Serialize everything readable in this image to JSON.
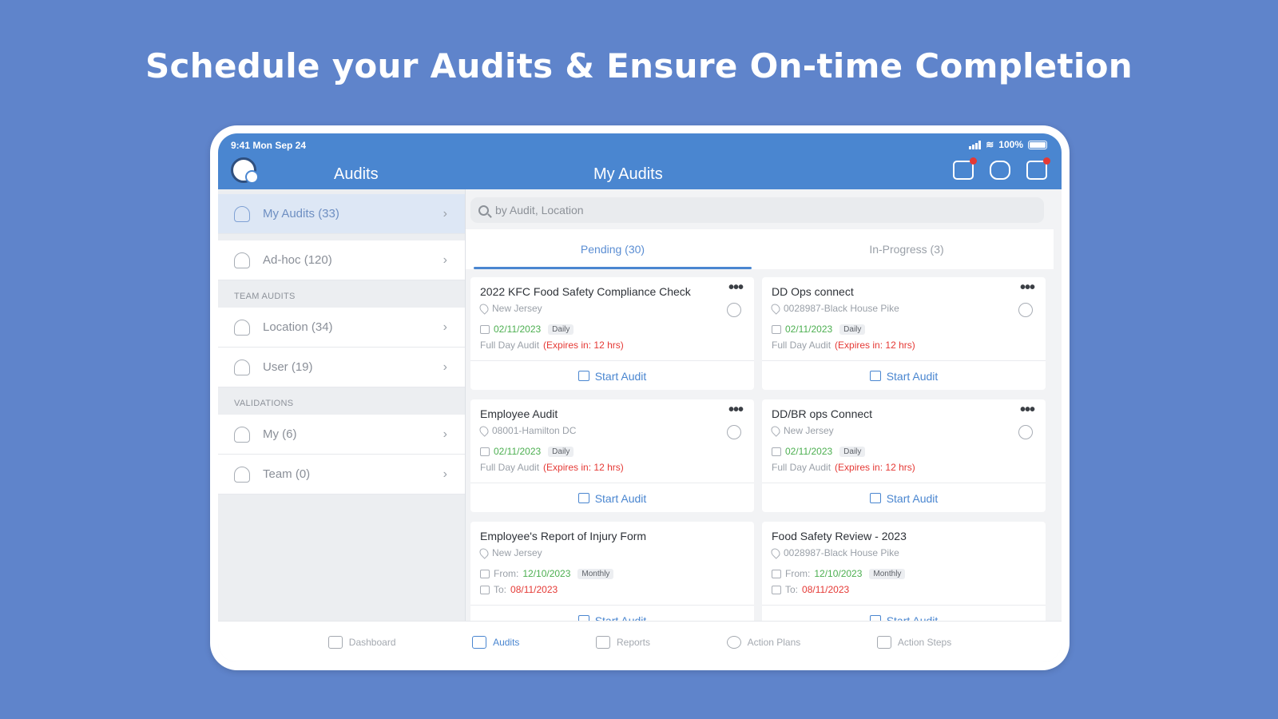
{
  "headline": "Schedule your Audits & Ensure On-time Completion",
  "status_bar": {
    "time": "9:41 Mon Sep 24",
    "battery": "100%"
  },
  "header": {
    "sidebar_title": "Audits",
    "main_title": "My Audits",
    "icons": [
      "audit-notification-icon",
      "chat-icon",
      "calendar-notification-icon"
    ]
  },
  "sidebar": {
    "items_top": [
      {
        "label": "My Audits (33)",
        "icon": "user-icon",
        "active": true
      },
      {
        "label": "Ad-hoc (120)",
        "icon": "user-icon"
      }
    ],
    "team_section": "TEAM AUDITS",
    "team_items": [
      {
        "label": "Location (34)",
        "icon": "location-icon"
      },
      {
        "label": "User (19)",
        "icon": "users-icon"
      }
    ],
    "validations_section": "VALIDATIONS",
    "validation_items": [
      {
        "label": "My (6)",
        "icon": "user-icon"
      },
      {
        "label": "Team (0)",
        "icon": "users-icon"
      }
    ]
  },
  "search": {
    "placeholder": "by Audit, Location"
  },
  "tabs": [
    {
      "label": "Pending (30)",
      "active": true
    },
    {
      "label": "In-Progress (3)"
    }
  ],
  "cards": [
    {
      "title": "2022 KFC Food Safety Compliance Check",
      "location": "New Jersey",
      "date": "02/11/2023",
      "freq": "Daily",
      "type": "Full Day Audit",
      "expires": "(Expires in: 12 hrs)",
      "action": "Start Audit"
    },
    {
      "title": "DD Ops connect",
      "location": "0028987-Black House Pike",
      "date": "02/11/2023",
      "freq": "Daily",
      "type": "Full Day Audit",
      "expires": "(Expires in: 12 hrs)",
      "action": "Start Audit"
    },
    {
      "title": "Employee Audit",
      "location": "08001-Hamilton DC",
      "date": "02/11/2023",
      "freq": "Daily",
      "type": "Full Day Audit",
      "expires": "(Expires in: 12 hrs)",
      "action": "Start Audit"
    },
    {
      "title": "DD/BR ops Connect",
      "location": "New Jersey",
      "date": "02/11/2023",
      "freq": "Daily",
      "type": "Full Day Audit",
      "expires": "(Expires in: 12 hrs)",
      "action": "Start Audit"
    },
    {
      "title": "Employee's Report of Injury Form",
      "location": "New Jersey",
      "from_label": "From:",
      "from": "12/10/2023",
      "freq": "Monthly",
      "to_label": "To:",
      "to": "08/11/2023",
      "action": "Start Audit"
    },
    {
      "title": "Food Safety Review - 2023",
      "location": "0028987-Black House Pike",
      "from_label": "From:",
      "from": "12/10/2023",
      "freq": "Monthly",
      "to_label": "To:",
      "to": "08/11/2023",
      "action": "Start Audit"
    }
  ],
  "bottom_nav": [
    {
      "label": "Dashboard",
      "icon": "dashboard-icon"
    },
    {
      "label": "Audits",
      "icon": "audits-icon",
      "active": true
    },
    {
      "label": "Reports",
      "icon": "reports-icon"
    },
    {
      "label": "Action Plans",
      "icon": "action-plans-icon"
    },
    {
      "label": "Action Steps",
      "icon": "action-steps-icon"
    }
  ],
  "colors": {
    "background": "#5f84cb",
    "header": "#4a86d0",
    "accent": "#4a86d0",
    "due_date": "#4caf50",
    "expires": "#e53935"
  }
}
